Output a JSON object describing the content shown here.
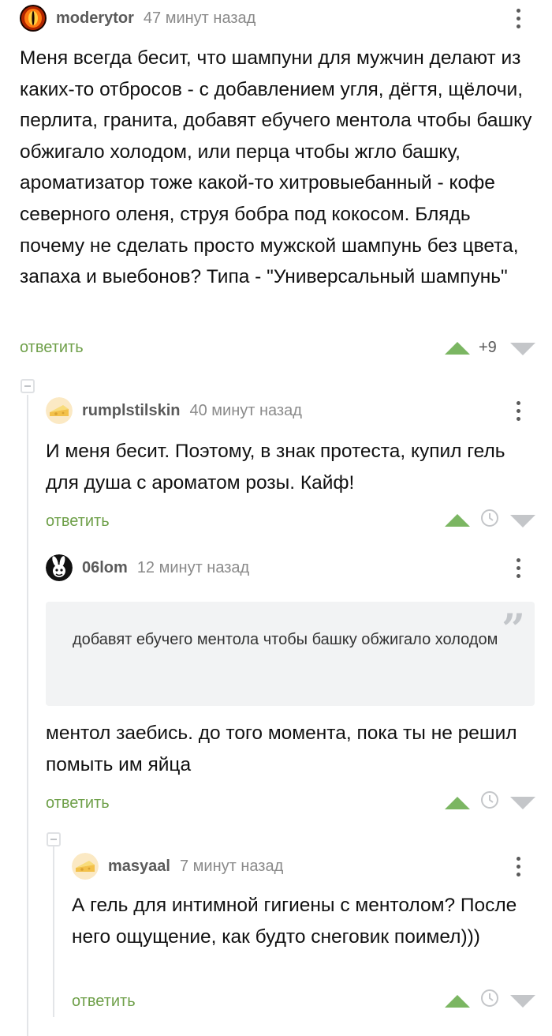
{
  "comments": [
    {
      "username": "moderytor",
      "time": "47 минут назад",
      "text": "Меня всегда бесит, что шампуни для мужчин делают из каких-то отбросов - с добавлением угля, дёгтя, щёлочи, перлита, гранита, добавят ебучего ментола чтобы башку обжигало холодом, или перца чтобы жгло башку, ароматизатор тоже какой-то хитровыебанный - кофе северного оленя, струя бобра под кокосом. Блядь почему не сделать просто мужской шампунь без цвета, запаха и выебонов? Типа - \"Универсальный шампунь\"",
      "reply_label": "ответить",
      "rating": "+9"
    },
    {
      "username": "rumplstilskin",
      "time": "40 минут назад",
      "text": "И меня бесит. Поэтому, в знак протеста, купил гель для душа с ароматом розы. Кайф!",
      "reply_label": "ответить"
    },
    {
      "username": "06lom",
      "time": "12 минут назад",
      "quote": "добавят ебучего ментола чтобы башку обжигало холодом",
      "text": "ментол заебись. до того момента, пока ты не решил помыть им яйца",
      "reply_label": "ответить"
    },
    {
      "username": "masyaal",
      "time": "7 минут назад",
      "text": "А гель для интимной гигиены с ментолом? После него ощущение, как будто снеговик поимел)))",
      "reply_label": "ответить"
    }
  ],
  "colors": {
    "reply_green": "#6fa04a",
    "upvote_green": "#7bb662",
    "downvote_gray": "#c4c6c9",
    "thread_line": "#e3e5e8"
  }
}
